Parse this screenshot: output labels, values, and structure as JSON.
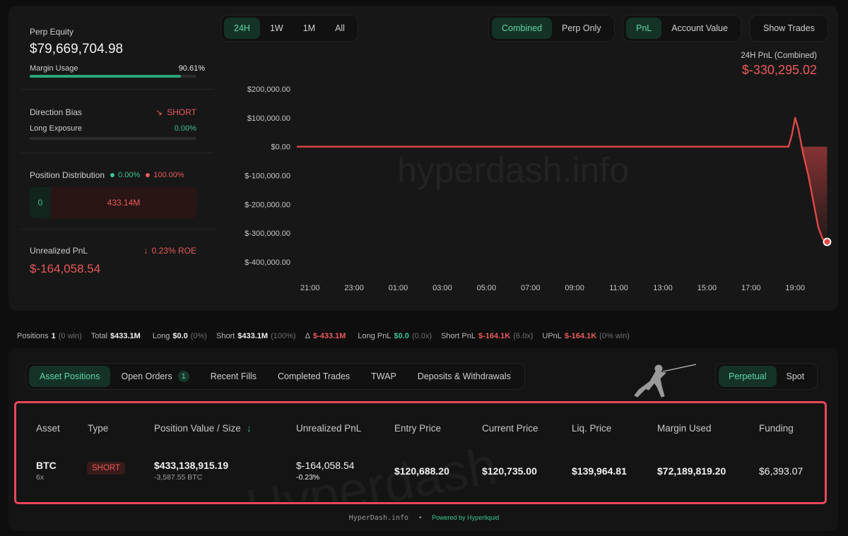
{
  "left": {
    "perp_equity_label": "Perp Equity",
    "perp_equity_value": "$79,669,704.98",
    "margin_usage_label": "Margin Usage",
    "margin_usage_value": "90.61%",
    "margin_usage_fraction": 0.9061,
    "direction_bias_label": "Direction Bias",
    "direction_bias_value": "SHORT",
    "long_exposure_label": "Long Exposure",
    "long_exposure_value": "0.00%",
    "long_exposure_fraction": 0,
    "position_dist_label": "Position Distribution",
    "dist_long_pct": "0.00%",
    "dist_short_pct": "100.00%",
    "dist_long_value": "0",
    "dist_short_value": "433.14M",
    "unrealized_pnl_label": "Unrealized PnL",
    "roe": "0.23% ROE",
    "unrealized_pnl_value": "$-164,058.54"
  },
  "controls": {
    "timeframes": [
      "24H",
      "1W",
      "1M",
      "All"
    ],
    "timeframe_active": "24H",
    "mode": [
      "Combined",
      "Perp Only"
    ],
    "mode_active": "Combined",
    "metric": [
      "PnL",
      "Account Value"
    ],
    "metric_active": "PnL",
    "show_trades": "Show Trades"
  },
  "chart_summary": {
    "label": "24H PnL (Combined)",
    "value": "$-330,295.02"
  },
  "chart_data": {
    "type": "area",
    "x_ticks": [
      "21:00",
      "23:00",
      "01:00",
      "03:00",
      "05:00",
      "07:00",
      "09:00",
      "11:00",
      "13:00",
      "15:00",
      "17:00",
      "19:00"
    ],
    "y_ticks": [
      "$200,000.00",
      "$100,000.00",
      "$0.00",
      "$-100,000.00",
      "$-200,000.00",
      "$-300,000.00",
      "$-400,000.00"
    ],
    "ylim": [
      -400000,
      200000
    ],
    "xlim_hours": [
      -0.6,
      23.5
    ],
    "series": [
      {
        "points": [
          [
            -0.6,
            0
          ],
          [
            21.7,
            0
          ],
          [
            21.85,
            40000
          ],
          [
            22.0,
            100000
          ],
          [
            22.15,
            60000
          ],
          [
            22.35,
            -20000
          ],
          [
            22.6,
            -100000
          ],
          [
            22.85,
            -200000
          ],
          [
            23.05,
            -280000
          ],
          [
            23.25,
            -320000
          ],
          [
            23.45,
            -330295
          ]
        ]
      }
    ],
    "watermark": "hyperdash.info",
    "color": "#e04848"
  },
  "stats": [
    {
      "label": "Positions",
      "value": "1",
      "meta": "(0 win)"
    },
    {
      "label": "Total",
      "value": "$433.1M",
      "meta": ""
    },
    {
      "label": "Long",
      "value": "$0.0",
      "meta": "(0%)"
    },
    {
      "label": "Short",
      "value": "$433.1M",
      "meta": "(100%)"
    },
    {
      "label": "Δ",
      "value": "$-433.1M",
      "meta": ""
    },
    {
      "label": "Long PnL",
      "value": "$0.0",
      "meta": "(0.0x)"
    },
    {
      "label": "Short PnL",
      "value": "$-164.1K",
      "meta": "(6.0x)"
    },
    {
      "label": "UPnL",
      "value": "$-164.1K",
      "meta": "(0% win)"
    }
  ],
  "tabs": {
    "items": [
      "Asset Positions",
      "Open Orders",
      "Recent Fills",
      "Completed Trades",
      "TWAP",
      "Deposits & Withdrawals"
    ],
    "active": "Asset Positions",
    "open_orders_count": "1",
    "market": [
      "Perpetual",
      "Spot"
    ],
    "market_active": "Perpetual"
  },
  "table": {
    "headers": [
      "Asset",
      "Type",
      "Position Value / Size",
      "Unrealized PnL",
      "Entry Price",
      "Current Price",
      "Liq. Price",
      "Margin Used",
      "Funding"
    ],
    "row": {
      "asset": "BTC",
      "leverage": "6x",
      "type": "SHORT",
      "position_value": "$433,138,915.19",
      "size": "-3,587.55 BTC",
      "pnl": "$-164,058.54",
      "pnl_pct": "-0.23%",
      "entry": "$120,688.20",
      "current": "$120,735.00",
      "liq": "$139,964.81",
      "margin": "$72,189,819.20",
      "funding": "$6,393.07"
    }
  },
  "footer": {
    "site": "HyperDash.info",
    "powered": "Powered by Hyperliquid"
  }
}
